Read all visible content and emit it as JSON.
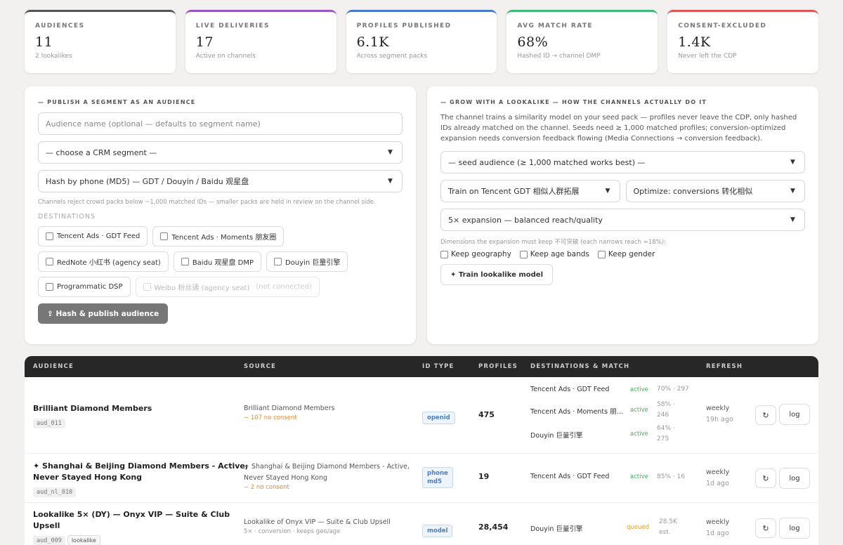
{
  "stats": [
    {
      "label": "Audiences",
      "value": "11",
      "sub": "2 lookalikes",
      "color": "#555555"
    },
    {
      "label": "Live deliveries",
      "value": "17",
      "sub": "Active on channels",
      "color": "#9a55c2"
    },
    {
      "label": "Profiles published",
      "value": "6.1K",
      "sub": "Across segment packs",
      "color": "#4a78c8"
    },
    {
      "label": "Avg match rate",
      "value": "68%",
      "sub": "Hashed ID → channel DMP",
      "color": "#3fb878"
    },
    {
      "label": "Consent-excluded",
      "value": "1.4K",
      "sub": "Never left the CDP",
      "color": "#e05555"
    }
  ],
  "publish": {
    "title": "— Publish a segment as an audience",
    "name_placeholder": "Audience name (optional — defaults to segment name)",
    "segment_select": "— choose a CRM segment —",
    "hash_select": "Hash by phone (MD5) — GDT / Douyin / Baidu 观星盘",
    "hint": "Channels reject crowd packs below ~1,000 matched IDs — smaller packs are held in review on the channel side.",
    "destinations_label": "Destinations",
    "destinations": [
      "Tencent Ads · GDT Feed",
      "Tencent Ads · Moments 朋友圈",
      "RedNote 小红书 (agency seat)",
      "Baidu 观星盘 DMP",
      "Douyin 巨量引擎",
      "Programmatic DSP"
    ],
    "disabled_destination": "Weibo 粉丝通 (agency seat)",
    "disabled_note": "(not connected)",
    "button": "⇪ Hash & publish audience"
  },
  "lookalike": {
    "title": "— Grow with a lookalike — how the channels actually do it",
    "description": "The channel trains a similarity model on your seed pack — profiles never leave the CDP, only hashed IDs already matched on the channel. Seeds need ≥ 1,000 matched profiles; conversion-optimized expansion needs conversion feedback flowing (Media Connections → conversion feedback).",
    "seed_select": "— seed audience (≥ 1,000 matched works best) —",
    "train_select": "Train on Tencent GDT 相似人群拓展",
    "optimize_select": "Optimize: conversions 转化相似",
    "expansion_select": "5× expansion — balanced reach/quality",
    "dims_hint": "Dimensions the expansion must keep 不可突破 (each narrows reach ≈18%):",
    "keep_geo": "Keep geography",
    "keep_age": "Keep age bands",
    "keep_gender": "Keep gender",
    "button": "✦ Train lookalike model"
  },
  "table": {
    "headers": {
      "audience": "Audience",
      "source": "Source",
      "idtype": "ID type",
      "profiles": "Profiles",
      "destinations": "Destinations & match",
      "refresh": "Refresh"
    },
    "rows": [
      {
        "name": "Brilliant Diamond Members",
        "code": "aud_011",
        "source": "Brilliant Diamond Members",
        "source_note": "− 107 no consent",
        "idtype": "openid",
        "profiles": "475",
        "dests": [
          {
            "name": "Tencent Ads · GDT Feed",
            "status": "active",
            "match": "70% · 297"
          },
          {
            "name": "Tencent Ads · Moments 朋…",
            "status": "active",
            "match": "58% ·",
            "match2": "246"
          },
          {
            "name": "Douyin 巨量引擎",
            "status": "active",
            "match": "64% ·",
            "match2": "275"
          }
        ],
        "refresh": "weekly",
        "ago": "19h ago",
        "log": "log"
      },
      {
        "name": "✦ Shanghai & Beijing Diamond Members - Active,",
        "name2": "Never Stayed Hong Kong",
        "code": "aud_nl_010",
        "source": "✦ Shanghai & Beijing Diamond Members - Active,",
        "source2": "Never Stayed Hong Kong",
        "source_note": "− 2 no consent",
        "idtype": "phone",
        "idtype2": "md5",
        "profiles": "19",
        "dests": [
          {
            "name": "Tencent Ads · GDT Feed",
            "status": "active",
            "match": "85% · 16"
          }
        ],
        "refresh": "weekly",
        "ago": "1d ago",
        "log": "log"
      },
      {
        "name": "Lookalike 5× (DY) — Onyx VIP — Suite & Club",
        "name2": "Upsell",
        "code": "aud_009",
        "tag": "lookalike",
        "source": "Lookalike of Onyx VIP — Suite & Club Upsell",
        "source_note": "5× · conversion · keeps geo/age",
        "idtype": "model",
        "profiles": "28,454",
        "dests": [
          {
            "name": "Douyin 巨量引擎",
            "status": "queued",
            "match": "28.5K",
            "match2": "est."
          }
        ],
        "refresh": "weekly",
        "ago": "1d ago",
        "log": "log"
      }
    ]
  }
}
